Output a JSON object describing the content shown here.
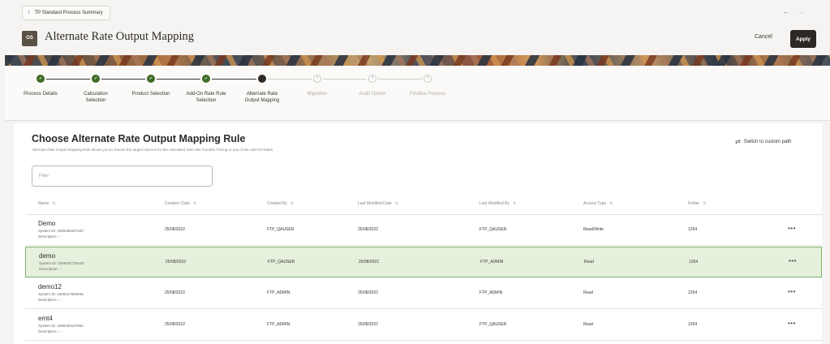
{
  "header": {
    "breadcrumb": "TP Standard Process Summary",
    "nav_back": "←",
    "nav_forward": "→",
    "badge": "OS",
    "title": "Alternate Rate Output Mapping",
    "cancel_label": "Cancel",
    "apply_label": "Apply"
  },
  "steps": [
    {
      "label": "Process Details",
      "state": "done",
      "mark": "✓"
    },
    {
      "label": "Calculation\nSelection",
      "state": "done",
      "mark": "✓"
    },
    {
      "label": "Product Selection",
      "state": "done",
      "mark": "✓"
    },
    {
      "label": "Add-On Rate Rule\nSelection",
      "state": "done",
      "mark": "✓"
    },
    {
      "label": "Alternate Rate\nOutput Mapping",
      "state": "current",
      "mark": ""
    },
    {
      "label": "Migration",
      "state": "todo",
      "mark": "?"
    },
    {
      "label": "Audit Option",
      "state": "todo",
      "mark": "?"
    },
    {
      "label": "Finalize Process",
      "state": "todo",
      "mark": "?"
    }
  ],
  "section": {
    "title": "Choose Alternate Rate Output Mapping Rule",
    "description": "Alternate Rate Output Mapping Rule allows you to choose the target columns for the calculated rates like Transfer Pricing or any of the Add-On Rates.",
    "switch_label": "Switch to custom path",
    "switch_icon": "⇄",
    "filter_placeholder": "Filter"
  },
  "table": {
    "sort_icon": "⇅",
    "columns": [
      "Name",
      "Creation Date",
      "Created By",
      "Last Modified Date",
      "Last Modified By",
      "Access Type",
      "Folder"
    ],
    "rows": [
      {
        "name": "Demo",
        "system_id": "System ID: 1665459497520",
        "description": "Description: --",
        "creation_date": "25/08/2022",
        "created_by": "FTP_QAUSER",
        "last_modified_date": "25/08/2022",
        "last_modified_by": "FTP_QAUSER",
        "access_type": "Read/Write",
        "folder": "1254",
        "selected": false
      },
      {
        "name": "demo",
        "system_id": "System ID: 1665457735100",
        "description": "Description: --",
        "creation_date": "25/08/2022",
        "created_by": "FTP_QAUSER",
        "last_modified_date": "25/08/2022",
        "last_modified_by": "FTP_ADMIN",
        "access_type": "Read",
        "folder": "1254",
        "selected": true
      },
      {
        "name": "demo12",
        "system_id": "System ID: 1665417883945",
        "description": "Description: --",
        "creation_date": "25/08/2022",
        "created_by": "FTP_ADMIN",
        "last_modified_date": "25/08/2022",
        "last_modified_by": "FTP_ADMIN",
        "access_type": "Read",
        "folder": "1254",
        "selected": false
      },
      {
        "name": "emt4",
        "system_id": "System ID: 1665260107952",
        "description": "Description: --",
        "creation_date": "25/08/2022",
        "created_by": "FTP_ADMIN",
        "last_modified_date": "25/08/2022",
        "last_modified_by": "FTP_QAUSER",
        "access_type": "Read",
        "folder": "1254",
        "selected": false
      }
    ],
    "more_icon": "•••"
  }
}
